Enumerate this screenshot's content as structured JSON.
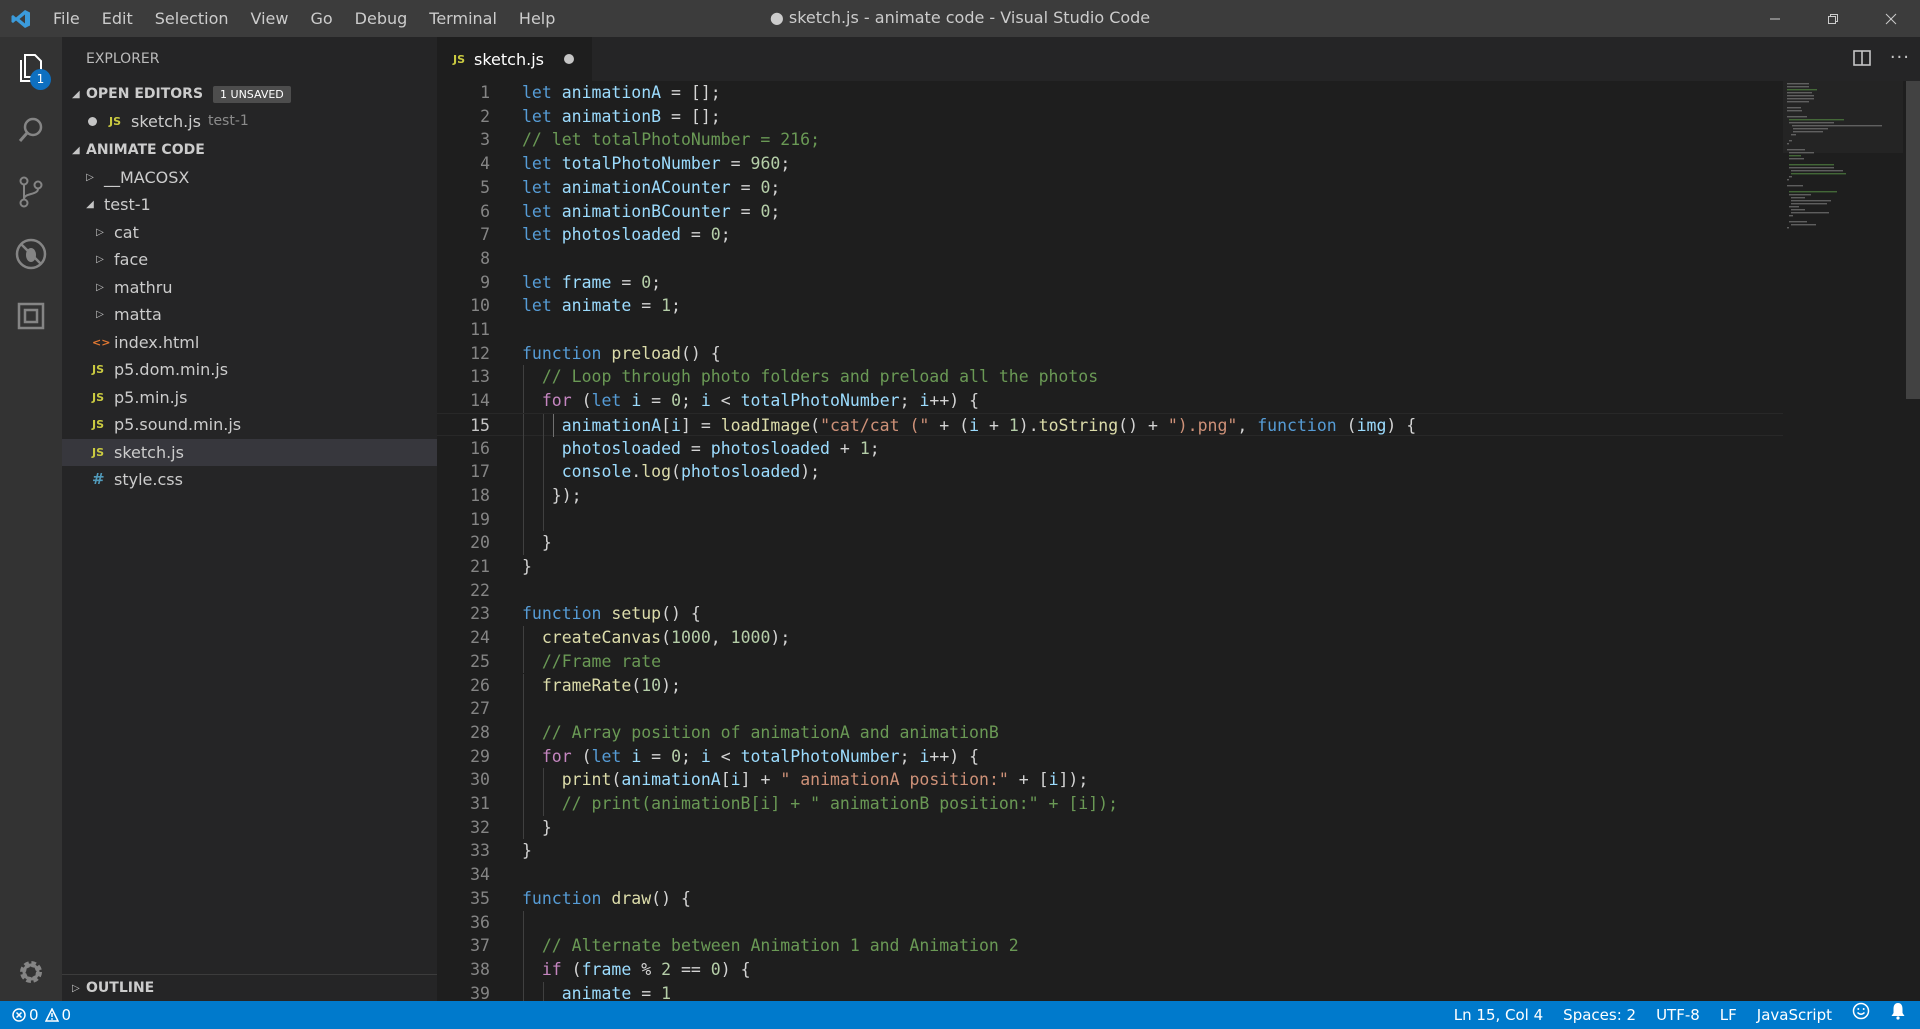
{
  "titlebar": {
    "menu": [
      "File",
      "Edit",
      "Selection",
      "View",
      "Go",
      "Debug",
      "Terminal",
      "Help"
    ],
    "title": "● sketch.js - animate code - Visual Studio Code"
  },
  "activity": {
    "explorer_badge": "1"
  },
  "sidebar": {
    "header": "EXPLORER",
    "open_editors": {
      "title": "OPEN EDITORS",
      "badge": "1 UNSAVED",
      "items": [
        {
          "name": "sketch.js",
          "folder": "test-1"
        }
      ]
    },
    "folder": {
      "title": "ANIMATE CODE",
      "items": [
        "__MACOSX",
        "test-1",
        "cat",
        "face",
        "mathru",
        "matta",
        "index.html",
        "p5.dom.min.js",
        "p5.min.js",
        "p5.sound.min.js",
        "sketch.js",
        "style.css"
      ]
    },
    "outline": "OUTLINE"
  },
  "tabs": [
    {
      "label": "sketch.js",
      "icon": "JS"
    }
  ],
  "editor": {
    "current_line": 15,
    "line_numbers": [
      "1",
      "2",
      "3",
      "4",
      "5",
      "6",
      "7",
      "8",
      "9",
      "10",
      "11",
      "12",
      "13",
      "14",
      "15",
      "16",
      "17",
      "18",
      "19",
      "20",
      "21",
      "22",
      "23",
      "24",
      "25",
      "26",
      "27",
      "28",
      "29",
      "30",
      "31",
      "32",
      "33",
      "34",
      "35",
      "36",
      "37",
      "38",
      "39"
    ]
  },
  "statusbar": {
    "errors": "0",
    "warnings": "0",
    "position": "Ln 15, Col 4",
    "spaces": "Spaces: 2",
    "encoding": "UTF-8",
    "eol": "LF",
    "language": "JavaScript"
  },
  "colors": {
    "accent": "#007acc",
    "badge": "#0e70c0",
    "keyword": "#569cd6",
    "control": "#c586c0",
    "variable": "#9cdcfe",
    "function": "#dcdcaa",
    "number": "#b5cea8",
    "string": "#ce9178",
    "comment": "#6a9955"
  }
}
